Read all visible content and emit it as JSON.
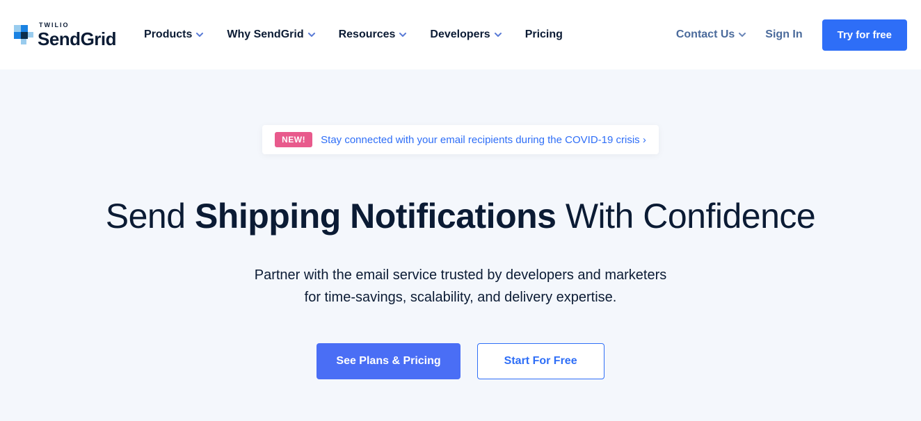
{
  "logo": {
    "tag": "TWILIO",
    "name": "SendGrid"
  },
  "nav": {
    "products": "Products",
    "why": "Why SendGrid",
    "resources": "Resources",
    "developers": "Developers",
    "pricing": "Pricing"
  },
  "right": {
    "contact": "Contact Us",
    "signin": "Sign In",
    "try": "Try for free"
  },
  "banner": {
    "tag": "NEW!",
    "text": "Stay connected with your email recipients during the COVID-19 crisis ›"
  },
  "headline": {
    "pre": "Send ",
    "bold": "Shipping Notifications",
    "post": " With Confidence"
  },
  "subhead": {
    "line1": "Partner with the email service trusted by developers and marketers",
    "line2": "for time-savings, scalability, and delivery expertise."
  },
  "cta": {
    "primary": "See Plans & Pricing",
    "secondary": "Start For Free"
  }
}
